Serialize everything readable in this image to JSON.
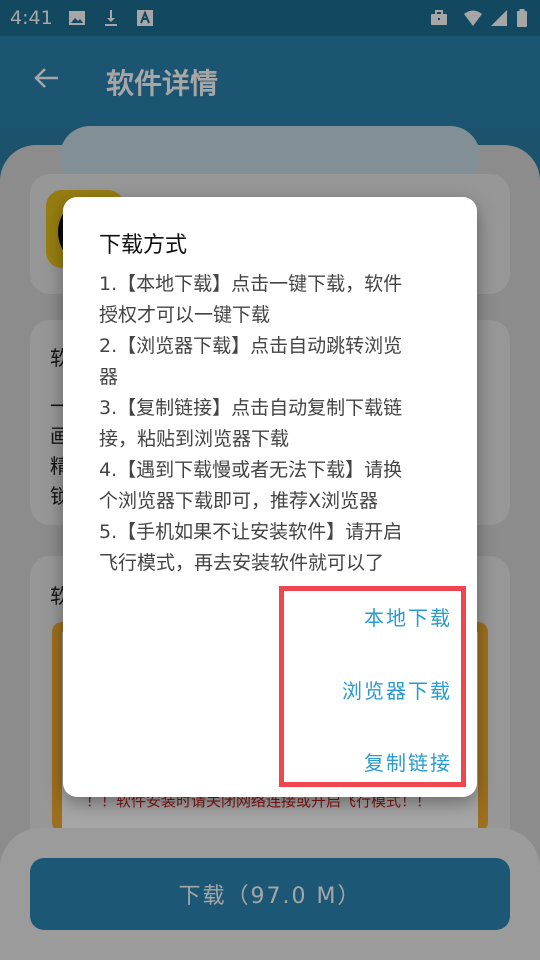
{
  "status_bar": {
    "time": "4:41",
    "left_icons": [
      "image-icon",
      "download-icon",
      "font-icon"
    ],
    "right_icons": [
      "briefcase-icon",
      "wifi-icon",
      "signal-icon",
      "battery-icon"
    ]
  },
  "app_bar": {
    "title": "软件详情",
    "back_icon": "arrow-back-icon"
  },
  "background": {
    "app_title_partial": "...",
    "section_prefix_1": "软",
    "desc_chars": [
      "一",
      "画",
      "精",
      "锁"
    ],
    "section_prefix_2": "软",
    "warning_text": "！！软件安装时请关闭网络连接或开启飞行模式！！",
    "download_button_label": "下载（97.0 M）"
  },
  "dialog": {
    "title": "下载方式",
    "lines": [
      "1.【本地下载】点击一键下载，软件",
      "授权才可以一键下载",
      "2.【浏览器下载】点击自动跳转浏览",
      "器",
      "3.【复制链接】点击自动复制下载链",
      "接，粘贴到浏览器下载",
      "4.【遇到下载慢或者无法下载】请换",
      "个浏览器下载即可，推荐X浏览器",
      "5.【手机如果不让安装软件】请开启",
      "飞行模式，再去安装软件就可以了"
    ],
    "actions": {
      "local": "本地下载",
      "browser": "浏览器下载",
      "copy": "复制链接"
    },
    "highlight_color": "#f0464f",
    "action_color": "#2a9bd0"
  }
}
